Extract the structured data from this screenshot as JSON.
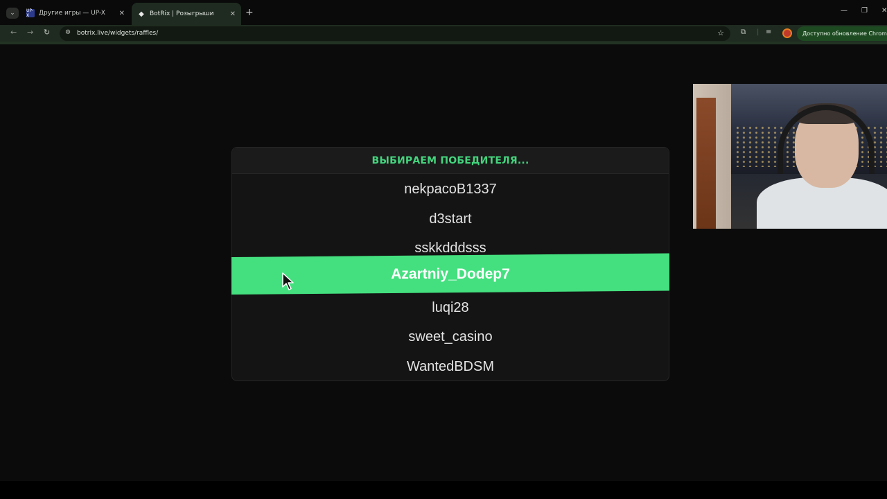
{
  "browser": {
    "tabs": [
      {
        "title": "Другие игры — UP-X",
        "favicon": "UP-X"
      },
      {
        "title": "BotRix | Розыгрыши",
        "favicon": "◆"
      }
    ],
    "url": "botrix.live/widgets/raffles/",
    "update_label": "Доступно обновление Chrome",
    "icons": {
      "tab_strip": "chevron-down-icon",
      "back": "arrow-left-icon",
      "forward": "arrow-right-icon",
      "reload": "reload-icon",
      "site_info": "site-settings-icon",
      "bookmark": "star-icon",
      "extensions": "puzzle-icon",
      "media": "media-queue-icon"
    },
    "accent": "#1f2b20"
  },
  "raffle": {
    "header": "ВЫБИРАЕМ ПОБЕДИТЕЛЯ...",
    "header_color": "#44d47e",
    "entries": [
      "nekpacoB1337",
      "d3start",
      "sskkdddsss",
      "luqi28",
      "sweet_casino",
      "WantedBDSM"
    ],
    "winner": "Azartniy_Dodep7",
    "winner_color": "#44e07f"
  }
}
